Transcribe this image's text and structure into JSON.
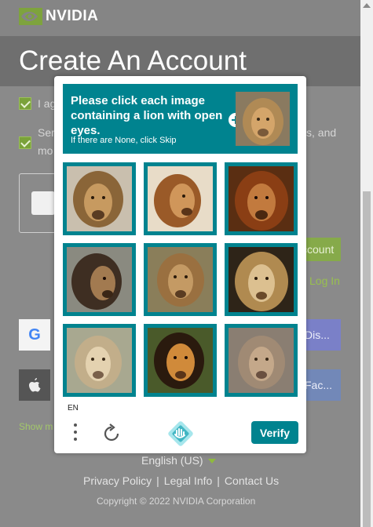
{
  "app": {
    "brand": "NVIDIA",
    "page_title": "Create An Account"
  },
  "background": {
    "checkbox1_text": "I ag",
    "checkbox2_text_line1": "Ser",
    "checkbox2_text_line1_end": "s, and",
    "checkbox2_text_line2": "mo",
    "create_button_partial": "ccount",
    "login_link_partial": "Log In",
    "google_letter": "G",
    "discord_partial": "Dis...",
    "facebook_partial": "Fac...",
    "apple_symbol": "",
    "show_more_partial": "Show m"
  },
  "footer": {
    "language": "English (US)",
    "links": [
      "Privacy Policy",
      "Legal Info",
      "Contact Us"
    ],
    "copyright": "Copyright © 2022 NVIDIA Corporation"
  },
  "captcha": {
    "prompt": "Please click each image containing a lion with open eyes.",
    "sub_prompt": "If there are None, click Skip",
    "language_code": "EN",
    "verify_label": "Verify",
    "accent_color": "#00838f",
    "tiles": [
      {
        "label": "lion-1"
      },
      {
        "label": "lion-2"
      },
      {
        "label": "lion-3"
      },
      {
        "label": "lion-4"
      },
      {
        "label": "lion-5"
      },
      {
        "label": "lion-6"
      },
      {
        "label": "lion-7"
      },
      {
        "label": "lion-8"
      },
      {
        "label": "lion-9"
      }
    ]
  },
  "icons": {
    "menu": "more-vertical-icon",
    "refresh": "refresh-icon",
    "brand": "hcaptcha-logo-icon",
    "plus": "plus-circle-icon"
  }
}
